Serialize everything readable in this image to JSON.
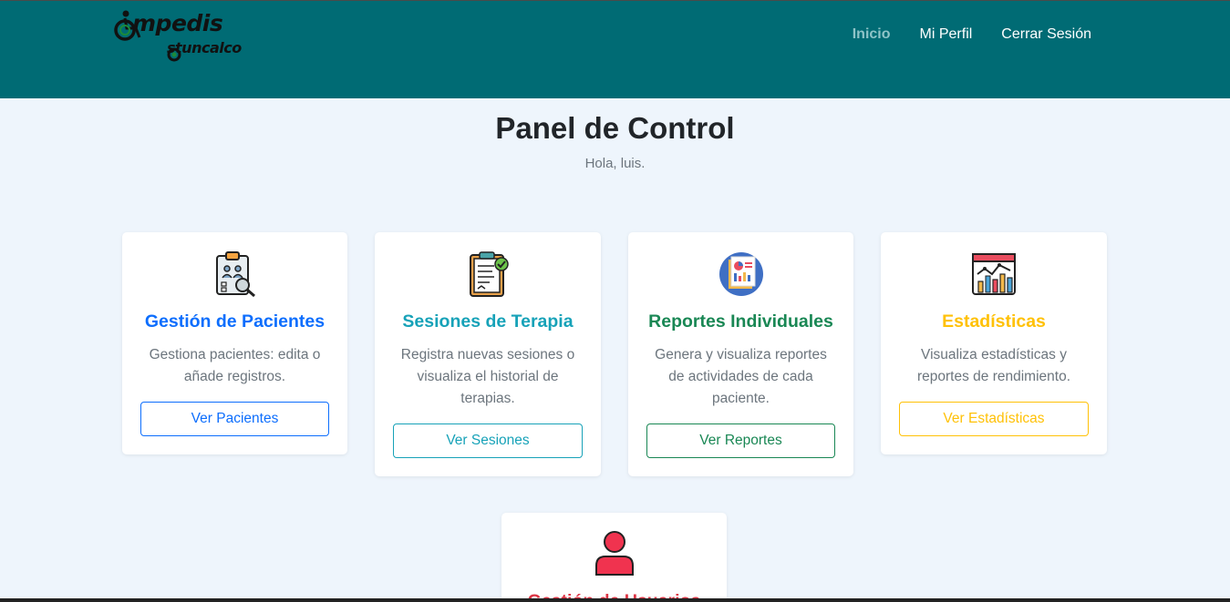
{
  "brand": {
    "line1": "mpedis",
    "line2": "stuncalco"
  },
  "nav": {
    "items": [
      {
        "label": "Inicio"
      },
      {
        "label": "Mi Perfil"
      },
      {
        "label": "Cerrar Sesión"
      }
    ]
  },
  "main": {
    "title": "Panel de Control",
    "greeting": "Hola, luis."
  },
  "cards": [
    {
      "title": "Gestión de Pacientes",
      "desc": "Gestiona pacientes: edita o añade registros.",
      "button": "Ver Pacientes",
      "icon": "clipboard-patients-icon",
      "color": "#0d6efd"
    },
    {
      "title": "Sesiones de Terapia",
      "desc": "Registra nuevas sesiones o visualiza el historial de terapias.",
      "button": "Ver Sesiones",
      "icon": "checklist-icon",
      "color": "#17a2b8"
    },
    {
      "title": "Reportes Individuales",
      "desc": "Genera y visualiza reportes de actividades de cada paciente.",
      "button": "Ver Reportes",
      "icon": "report-icon",
      "color": "#198754"
    },
    {
      "title": "Estadísticas",
      "desc": "Visualiza estadísticas y reportes de rendimiento.",
      "button": "Ver Estadísticas",
      "icon": "statistics-chart-icon",
      "color": "#ffc107"
    },
    {
      "title": "Gestión de Usuarios",
      "icon": "user-icon",
      "color": "#dc3545"
    }
  ]
}
